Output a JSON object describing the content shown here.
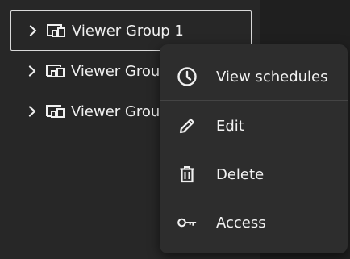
{
  "tree": {
    "groups": [
      {
        "label": "Viewer Group 1",
        "selected": true
      },
      {
        "label": "Viewer Group",
        "selected": false
      },
      {
        "label": "Viewer Group",
        "selected": false
      }
    ]
  },
  "context_menu": {
    "items": [
      {
        "label": "View schedules",
        "icon": "clock-icon"
      },
      {
        "label": "Edit",
        "icon": "pencil-icon"
      },
      {
        "label": "Delete",
        "icon": "trash-icon"
      },
      {
        "label": "Access",
        "icon": "key-icon"
      }
    ]
  },
  "colors": {
    "background": "#272727",
    "menu_background": "#2d2d2d",
    "text": "#f0f0f0",
    "selection_border": "#d9d9d9"
  }
}
